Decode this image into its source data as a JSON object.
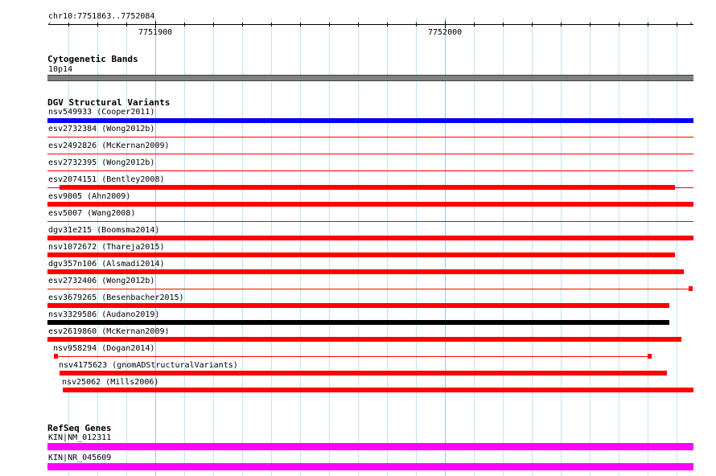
{
  "ruler": {
    "region": "chr10:7751863..7752084",
    "tick_labels": [
      "7751900",
      "7752000"
    ]
  },
  "colors": {
    "grid": "#bfe3f2",
    "cytoband": "#808080",
    "dgv_gain": "#0000ff",
    "dgv_loss": "#ff0000",
    "dgv_complex": "#000000",
    "refseq": "#ff00ff"
  },
  "tracks": {
    "cytobands": {
      "title": "Cytogenetic Bands",
      "features": [
        {
          "label": "10p14",
          "color": "#808080"
        }
      ]
    },
    "dgv": {
      "title": "DGV Structural Variants",
      "features": [
        {
          "label": "nsv549933 (Cooper2011)",
          "color": "#0000ff"
        },
        {
          "label": "esv2732384 (Wong2012b)",
          "color": "#ff0000"
        },
        {
          "label": "esv2492826 (McKernan2009)",
          "color": "#ff0000"
        },
        {
          "label": "esv2732395 (Wong2012b)",
          "color": "#ff0000"
        },
        {
          "label": "esv2074151 (Bentley2008)",
          "color": "#ff0000"
        },
        {
          "label": "esv9005 (Ahn2009)",
          "color": "#ff0000"
        },
        {
          "label": "esv5007 (Wang2008)",
          "color": "#ff0000"
        },
        {
          "label": "dgv31e215 (Boomsma2014)",
          "color": "#ff0000"
        },
        {
          "label": "nsv1072672 (Thareja2015)",
          "color": "#ff0000"
        },
        {
          "label": "dgv357n106 (Alsmadi2014)",
          "color": "#ff0000"
        },
        {
          "label": "esv2732406 (Wong2012b)",
          "color": "#ff0000"
        },
        {
          "label": "esv3679265 (Besenbacher2015)",
          "color": "#ff0000"
        },
        {
          "label": "nsv3329586 (Audano2019)",
          "color": "#000000"
        },
        {
          "label": "esv2619860 (McKernan2009)",
          "color": "#ff0000"
        },
        {
          "label": "nsv958294 (Dogan2014)",
          "color": "#ff0000"
        },
        {
          "label": "nsv4175623 (gnomADStructuralVariants)",
          "color": "#ff0000"
        },
        {
          "label": "nsv25062 (Mills2006)",
          "color": "#ff0000"
        }
      ]
    },
    "refseq": {
      "title": "RefSeq Genes",
      "features": [
        {
          "label": "KIN|NM_012311",
          "color": "#ff00ff"
        },
        {
          "label": "KIN|NR_045609",
          "color": "#ff00ff"
        }
      ]
    }
  }
}
